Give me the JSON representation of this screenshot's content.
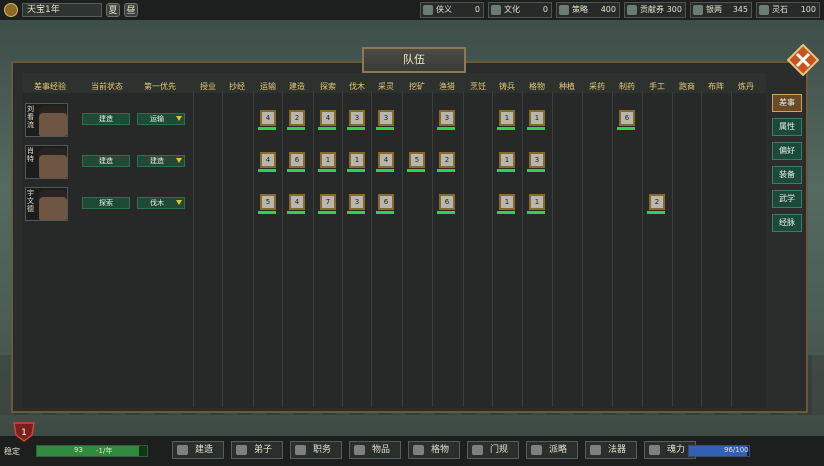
{
  "topbar": {
    "date": "天宝1年",
    "season_summer": "夏",
    "season_autumn": "昼",
    "resources": [
      {
        "icon": "chivalry-icon",
        "label": "侠义",
        "value": "0"
      },
      {
        "icon": "culture-icon",
        "label": "文化",
        "value": "0"
      },
      {
        "icon": "strategy-icon",
        "label": "策略",
        "value": "400"
      },
      {
        "icon": "coupon-icon",
        "label": "贡献券",
        "value": "300"
      },
      {
        "icon": "grain-icon",
        "label": "银两",
        "value": "345"
      },
      {
        "icon": "spirit-stone-icon",
        "label": "灵石",
        "value": "100"
      }
    ]
  },
  "panel": {
    "title": "队伍",
    "headers": [
      "差事经验",
      "当前状态",
      "第一优先",
      "授业",
      "抄经",
      "运输",
      "建造",
      "探索",
      "伐木",
      "采灵",
      "挖矿",
      "渔猎",
      "烹饪",
      "铸兵",
      "格物",
      "种植",
      "采药",
      "制药",
      "手工",
      "跑商",
      "布阵",
      "炼丹"
    ],
    "members": [
      {
        "name": "刘看流",
        "status": "建造",
        "priority": "运输",
        "skills": {
          "运输": "4",
          "建造": "2",
          "探索": "4",
          "伐木": "3",
          "采灵": "3",
          "渔猎": "3",
          "铸兵": "1",
          "格物": "1",
          "制药": "6"
        }
      },
      {
        "name": "肖特",
        "status": "建造",
        "priority": "建造",
        "skills": {
          "运输": "4",
          "建造": "6",
          "探索": "1",
          "伐木": "1",
          "采灵": "4",
          "挖矿": "5",
          "渔猎": "2",
          "铸兵": "1",
          "格物": "3"
        }
      },
      {
        "name": "宇文德",
        "status": "探索",
        "priority": "伐木",
        "skills": {
          "运输": "5",
          "建造": "4",
          "探索": "7",
          "伐木": "3",
          "采灵": "6",
          "渔猎": "6",
          "铸兵": "1",
          "格物": "1",
          "手工": "2"
        }
      }
    ],
    "side_tabs": [
      "差事",
      "属性",
      "偏好",
      "装备",
      "武学",
      "经脉"
    ]
  },
  "bottombar": {
    "stability_label": "稳定",
    "stability_value": "93",
    "stability_rate": "-1/年",
    "stability_fill": 0.93,
    "buttons": [
      "建造",
      "弟子",
      "职务",
      "物品",
      "格物",
      "门规",
      "派略",
      "法器",
      "魂力"
    ],
    "soul_value": "96/100",
    "soul_fill": 0.96
  },
  "colors": {
    "accent": "#e5c775",
    "green_bar": "#2fd24e",
    "active_tab": "#6b4a28"
  }
}
